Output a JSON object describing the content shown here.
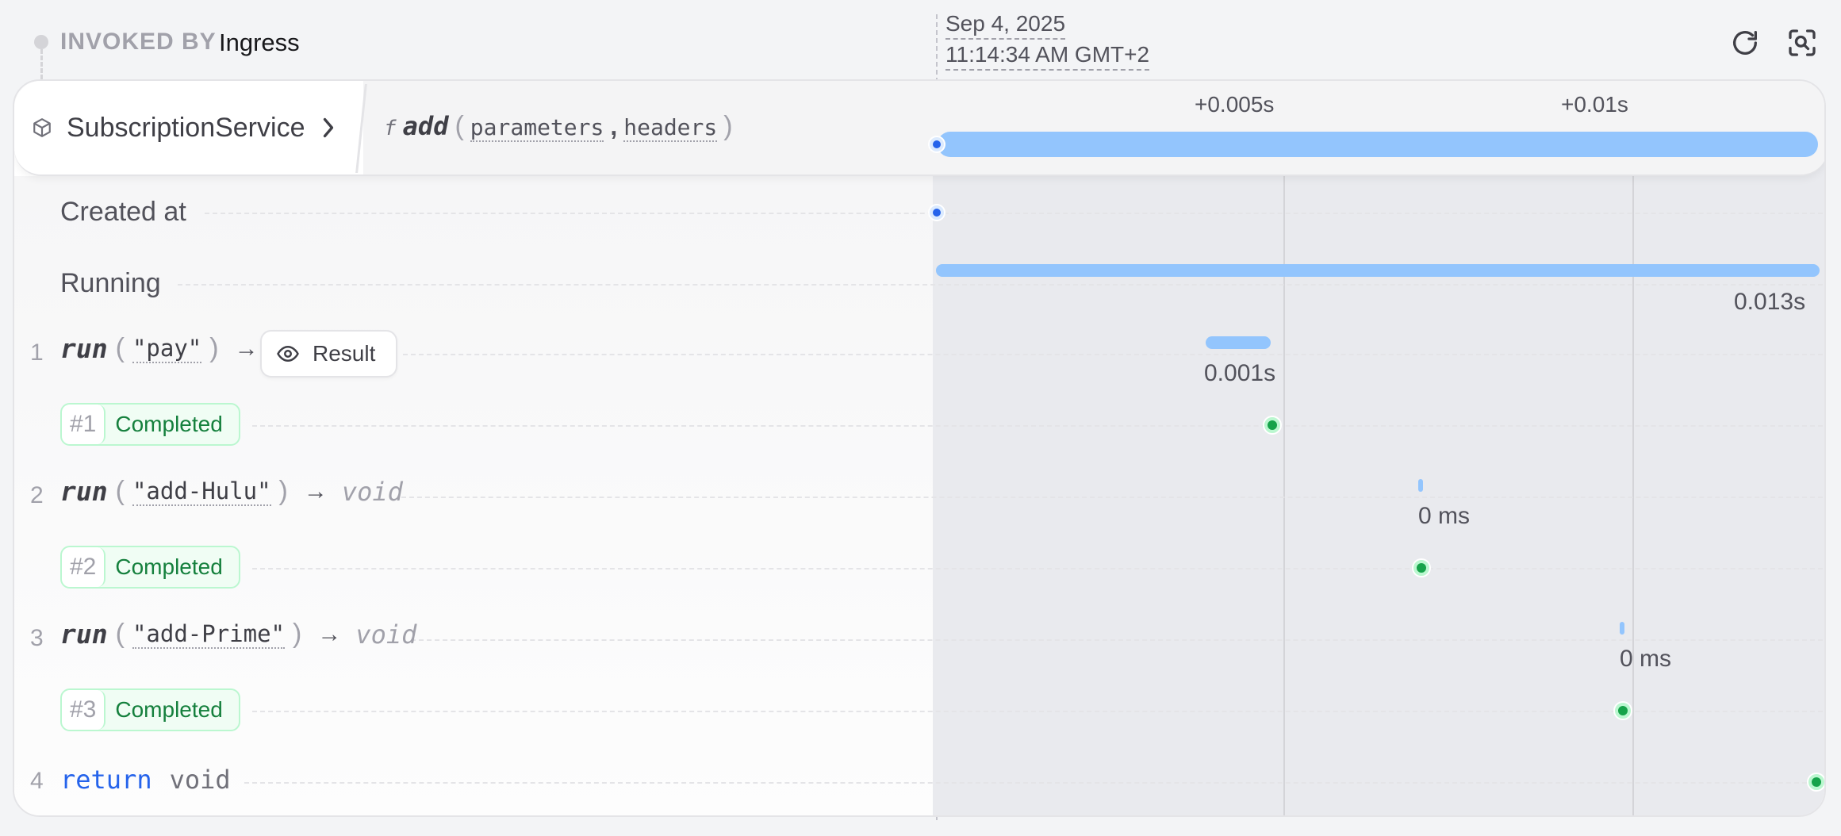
{
  "invocation": {
    "invoked_by_label": "INVOKED BY",
    "invoked_by_value": "Ingress",
    "date": "Sep 4, 2025",
    "time": "11:14:34 AM GMT+2"
  },
  "toolbar": {
    "refresh_icon": "refresh-icon",
    "inspect_icon": "zoom-inspect-icon"
  },
  "service": {
    "name": "SubscriptionService",
    "icon": "cube-icon"
  },
  "handler": {
    "fn_symbol": "f",
    "name": "add",
    "params": [
      "parameters",
      "headers"
    ],
    "comma": ","
  },
  "axis": {
    "ticks": [
      "+0.005s",
      "+0.01s"
    ]
  },
  "rows": {
    "created_at": {
      "label": "Created at"
    },
    "running": {
      "label": "Running",
      "duration": "0.013s"
    },
    "steps": [
      {
        "num": "1",
        "kw": "run",
        "arg": "\"pay\"",
        "arrow": "→",
        "result_label": "Result",
        "duration": "0.001s",
        "attempt": "#1",
        "status": "Completed"
      },
      {
        "num": "2",
        "kw": "run",
        "arg": "\"add-Hulu\"",
        "arrow": "→",
        "returns": "void",
        "duration": "0 ms",
        "attempt": "#2",
        "status": "Completed"
      },
      {
        "num": "3",
        "kw": "run",
        "arg": "\"add-Prime\"",
        "arrow": "→",
        "returns": "void",
        "duration": "0 ms",
        "attempt": "#3",
        "status": "Completed"
      }
    ],
    "return_row": {
      "num": "4",
      "kw": "return",
      "value": "void"
    }
  },
  "colors": {
    "accent": "#93c5fd",
    "dot_blue": "#2563eb",
    "success": "#16a34a",
    "success_text": "#15803d"
  }
}
